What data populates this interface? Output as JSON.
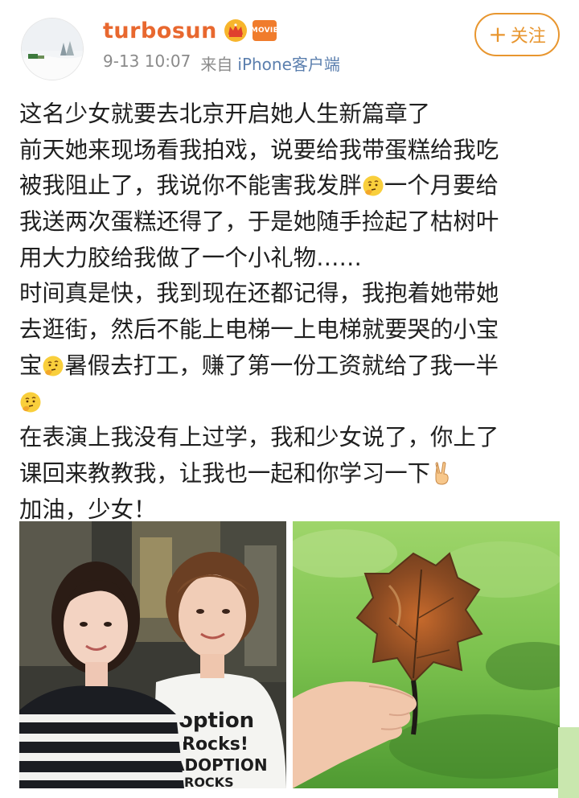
{
  "post": {
    "author": {
      "username": "turbosun",
      "avatar_icon": "snowy-landscape-avatar",
      "badges": [
        "crown-badge-icon",
        "movie-badge-icon"
      ],
      "movie_badge_text": "MOVIE"
    },
    "timestamp": "9-13 10:07",
    "source_prefix": "来自",
    "source_client": "iPhone客户端",
    "follow_button": {
      "plus": "+",
      "label": "关注"
    },
    "text_lines": [
      "这名少女就要去北京开启她人生新篇章了",
      "前天她来现场看我拍戏，说要给我带蛋糕给我吃",
      "被我阻止了，我说你不能害我发胖",
      "一个月要给",
      "我送两次蛋糕还得了，于是她随手捡起了枯树叶",
      "用大力胶给我做了一个小礼物……",
      "时间真是快，我到现在还都记得，我抱着她带她",
      "去逛街，然后不能上电梯一上电梯就要哭的小宝",
      "宝",
      "暑假去打工，赚了第一份工资就给了我一半",
      "在表演上我没有上过学，我和少女说了，你上了",
      "课回来教教我，让我也一起和你学习一下",
      "加油，少女！"
    ],
    "emoji": {
      "thinking": "thinking-emoji-icon",
      "victory": "victory-hand-emoji-icon"
    },
    "photos": [
      {
        "name": "photo-two-women",
        "shirt_text": [
          "option",
          "Rocks!",
          "ADOPTION",
          "ROCKS"
        ]
      },
      {
        "name": "photo-leaf-gift"
      }
    ],
    "colors": {
      "username": "#e8682f",
      "follow": "#e8962f",
      "client_link": "#5b7fae",
      "meta": "#8a8a8a"
    }
  }
}
